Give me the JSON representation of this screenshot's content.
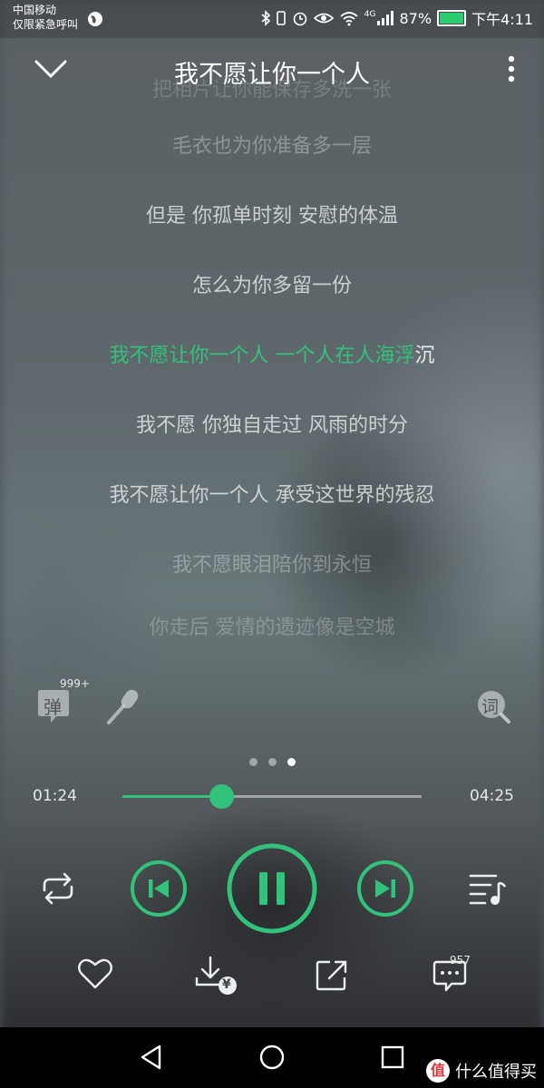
{
  "status_bar": {
    "carrier": "中国移动",
    "emergency": "仅限紧急呼叫",
    "network": "4G",
    "battery": "87%",
    "time": "下午4:11"
  },
  "header": {
    "title": "我不愿让你一个人",
    "back_icon": "chevron-down-icon",
    "more_icon": "more-vertical-icon"
  },
  "lyrics": [
    {
      "text": "把相片让你能保存多洗一张",
      "state": "fade-top"
    },
    {
      "text": "毛衣也为你准备多一层",
      "state": "dim"
    },
    {
      "text": "但是 你孤单时刻 安慰的体温",
      "state": "normal"
    },
    {
      "text": "怎么为你多留一份",
      "state": "normal"
    },
    {
      "text_highlight": "我不愿让你一个人 一个人在人海浮",
      "text_rest": "沉",
      "state": "active"
    },
    {
      "text": "我不愿 你独自走过 风雨的时分",
      "state": "normal"
    },
    {
      "text": "我不愿让你一个人 承受这世界的残忍",
      "state": "normal"
    },
    {
      "text": "我不愿眼泪陪你到永恒",
      "state": "dim"
    },
    {
      "text": "你走后 爱情的遗迹像是空城",
      "state": "fade-bottom"
    }
  ],
  "tools": {
    "danmaku_label": "弹",
    "danmaku_count": "999+",
    "mic_icon": "microphone-icon",
    "lyrics_search_label": "词"
  },
  "pager": {
    "pages": 3,
    "current": 3
  },
  "progress": {
    "elapsed": "01:24",
    "total": "04:25",
    "fraction": 0.33
  },
  "controls": {
    "repeat_icon": "repeat-icon",
    "prev_icon": "skip-previous-icon",
    "play_state_icon": "pause-icon",
    "next_icon": "skip-next-icon",
    "playlist_icon": "playlist-icon"
  },
  "actions": {
    "like_icon": "heart-icon",
    "download_icon": "download-paid-icon",
    "download_badge": "¥",
    "share_icon": "share-icon",
    "comment_icon": "comment-icon",
    "comment_count": "957"
  },
  "watermark": {
    "logo": "值",
    "text": "什么值得买"
  },
  "colors": {
    "accent": "#31c27c",
    "navbar": "#000000"
  }
}
